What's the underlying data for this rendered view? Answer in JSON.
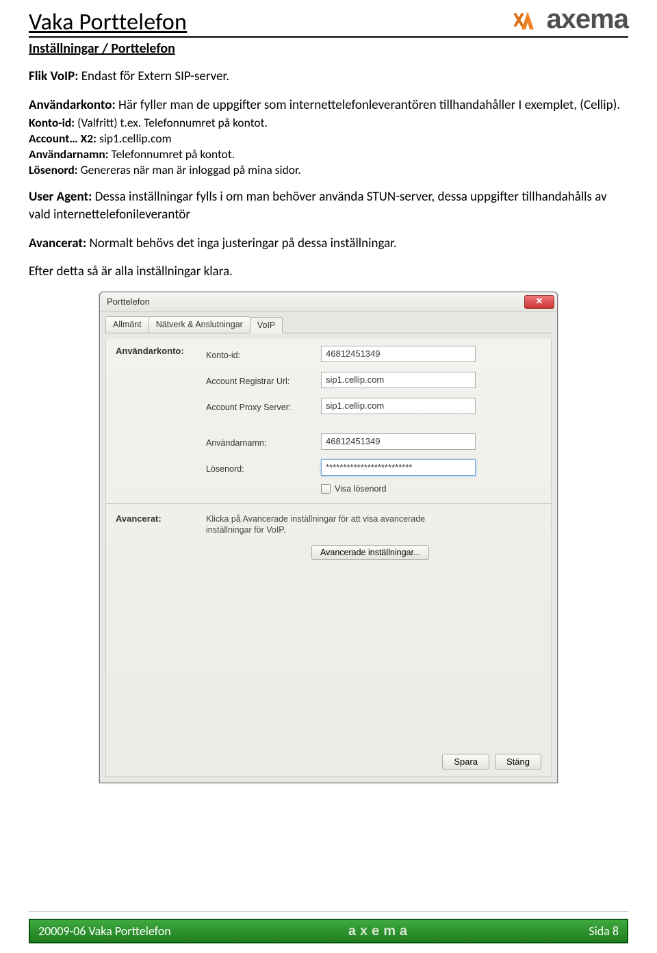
{
  "header": {
    "page_title": "Vaka Porttelefon",
    "subheading": "Inställningar / Porttelefon",
    "logo_text": "axema"
  },
  "body": {
    "flik_label": "Flik VoIP:",
    "flik_text": " Endast för Extern SIP-server.",
    "anvandarkonto_label": "Användarkonto:",
    "anvandarkonto_text": " Här fyller man de uppgifter som internettelefonleverantören tillhandahåller I exemplet, (Cellip).",
    "konto_id_label": "Konto-id:",
    "konto_id_text": " (Valfritt) t.ex. Telefonnumret på kontot.",
    "account_label": "Account… X2:",
    "account_text": " sip1.cellip.com",
    "anvandarnamn_label": "Användarnamn:",
    "anvandarnamn_text": " Telefonnumret på kontot.",
    "losenord_label": "Lösenord:",
    "losenord_text": " Genereras när man är inloggad på mina sidor.",
    "useragent_label": "User Agent:",
    "useragent_text": " Dessa inställningar fylls i om man behöver använda STUN-server, dessa uppgifter tillhandahålls av vald internettelefonileverantör",
    "avancerat_label": "Avancerat:",
    "avancerat_text": " Normalt behövs det inga justeringar på dessa inställningar.",
    "efter_text": "Efter detta så är alla inställningar klara."
  },
  "window": {
    "title": "Porttelefon",
    "close": "✕",
    "tabs": [
      "Allmänt",
      "Nätverk & Anslutningar",
      "VoIP"
    ],
    "section1": "Användarkonto:",
    "fields": {
      "konto_id": {
        "label": "Konto-id:",
        "value": "46812451349"
      },
      "registrar": {
        "label": "Account Registrar Url:",
        "value": "sip1.cellip.com"
      },
      "proxy": {
        "label": "Account Proxy Server:",
        "value": "sip1.cellip.com"
      },
      "username": {
        "label": "Användarnamn:",
        "value": "46812451349"
      },
      "password": {
        "label": "Lösenord:",
        "value": "*************************"
      },
      "show_pw": "Visa lösenord"
    },
    "section2": "Avancerat:",
    "adv_hint": "Klicka på Avancerade inställningar för att visa avancerade inställningar för VoIP.",
    "adv_button": "Avancerade inställningar...",
    "save": "Spara",
    "close_btn": "Stäng"
  },
  "footer": {
    "left": "20009-06 Vaka Porttelefon",
    "logo": "axema",
    "right": "Sida 8"
  }
}
